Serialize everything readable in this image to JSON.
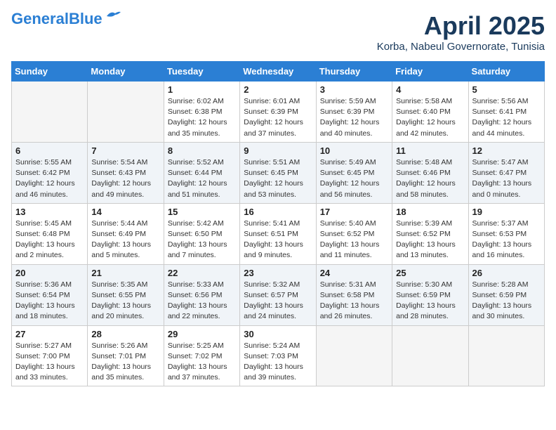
{
  "header": {
    "logo_line1": "General",
    "logo_line2": "Blue",
    "month_year": "April 2025",
    "location": "Korba, Nabeul Governorate, Tunisia"
  },
  "weekdays": [
    "Sunday",
    "Monday",
    "Tuesday",
    "Wednesday",
    "Thursday",
    "Friday",
    "Saturday"
  ],
  "weeks": [
    [
      {
        "day": "",
        "detail": ""
      },
      {
        "day": "",
        "detail": ""
      },
      {
        "day": "1",
        "detail": "Sunrise: 6:02 AM\nSunset: 6:38 PM\nDaylight: 12 hours\nand 35 minutes."
      },
      {
        "day": "2",
        "detail": "Sunrise: 6:01 AM\nSunset: 6:39 PM\nDaylight: 12 hours\nand 37 minutes."
      },
      {
        "day": "3",
        "detail": "Sunrise: 5:59 AM\nSunset: 6:39 PM\nDaylight: 12 hours\nand 40 minutes."
      },
      {
        "day": "4",
        "detail": "Sunrise: 5:58 AM\nSunset: 6:40 PM\nDaylight: 12 hours\nand 42 minutes."
      },
      {
        "day": "5",
        "detail": "Sunrise: 5:56 AM\nSunset: 6:41 PM\nDaylight: 12 hours\nand 44 minutes."
      }
    ],
    [
      {
        "day": "6",
        "detail": "Sunrise: 5:55 AM\nSunset: 6:42 PM\nDaylight: 12 hours\nand 46 minutes."
      },
      {
        "day": "7",
        "detail": "Sunrise: 5:54 AM\nSunset: 6:43 PM\nDaylight: 12 hours\nand 49 minutes."
      },
      {
        "day": "8",
        "detail": "Sunrise: 5:52 AM\nSunset: 6:44 PM\nDaylight: 12 hours\nand 51 minutes."
      },
      {
        "day": "9",
        "detail": "Sunrise: 5:51 AM\nSunset: 6:45 PM\nDaylight: 12 hours\nand 53 minutes."
      },
      {
        "day": "10",
        "detail": "Sunrise: 5:49 AM\nSunset: 6:45 PM\nDaylight: 12 hours\nand 56 minutes."
      },
      {
        "day": "11",
        "detail": "Sunrise: 5:48 AM\nSunset: 6:46 PM\nDaylight: 12 hours\nand 58 minutes."
      },
      {
        "day": "12",
        "detail": "Sunrise: 5:47 AM\nSunset: 6:47 PM\nDaylight: 13 hours\nand 0 minutes."
      }
    ],
    [
      {
        "day": "13",
        "detail": "Sunrise: 5:45 AM\nSunset: 6:48 PM\nDaylight: 13 hours\nand 2 minutes."
      },
      {
        "day": "14",
        "detail": "Sunrise: 5:44 AM\nSunset: 6:49 PM\nDaylight: 13 hours\nand 5 minutes."
      },
      {
        "day": "15",
        "detail": "Sunrise: 5:42 AM\nSunset: 6:50 PM\nDaylight: 13 hours\nand 7 minutes."
      },
      {
        "day": "16",
        "detail": "Sunrise: 5:41 AM\nSunset: 6:51 PM\nDaylight: 13 hours\nand 9 minutes."
      },
      {
        "day": "17",
        "detail": "Sunrise: 5:40 AM\nSunset: 6:52 PM\nDaylight: 13 hours\nand 11 minutes."
      },
      {
        "day": "18",
        "detail": "Sunrise: 5:39 AM\nSunset: 6:52 PM\nDaylight: 13 hours\nand 13 minutes."
      },
      {
        "day": "19",
        "detail": "Sunrise: 5:37 AM\nSunset: 6:53 PM\nDaylight: 13 hours\nand 16 minutes."
      }
    ],
    [
      {
        "day": "20",
        "detail": "Sunrise: 5:36 AM\nSunset: 6:54 PM\nDaylight: 13 hours\nand 18 minutes."
      },
      {
        "day": "21",
        "detail": "Sunrise: 5:35 AM\nSunset: 6:55 PM\nDaylight: 13 hours\nand 20 minutes."
      },
      {
        "day": "22",
        "detail": "Sunrise: 5:33 AM\nSunset: 6:56 PM\nDaylight: 13 hours\nand 22 minutes."
      },
      {
        "day": "23",
        "detail": "Sunrise: 5:32 AM\nSunset: 6:57 PM\nDaylight: 13 hours\nand 24 minutes."
      },
      {
        "day": "24",
        "detail": "Sunrise: 5:31 AM\nSunset: 6:58 PM\nDaylight: 13 hours\nand 26 minutes."
      },
      {
        "day": "25",
        "detail": "Sunrise: 5:30 AM\nSunset: 6:59 PM\nDaylight: 13 hours\nand 28 minutes."
      },
      {
        "day": "26",
        "detail": "Sunrise: 5:28 AM\nSunset: 6:59 PM\nDaylight: 13 hours\nand 30 minutes."
      }
    ],
    [
      {
        "day": "27",
        "detail": "Sunrise: 5:27 AM\nSunset: 7:00 PM\nDaylight: 13 hours\nand 33 minutes."
      },
      {
        "day": "28",
        "detail": "Sunrise: 5:26 AM\nSunset: 7:01 PM\nDaylight: 13 hours\nand 35 minutes."
      },
      {
        "day": "29",
        "detail": "Sunrise: 5:25 AM\nSunset: 7:02 PM\nDaylight: 13 hours\nand 37 minutes."
      },
      {
        "day": "30",
        "detail": "Sunrise: 5:24 AM\nSunset: 7:03 PM\nDaylight: 13 hours\nand 39 minutes."
      },
      {
        "day": "",
        "detail": ""
      },
      {
        "day": "",
        "detail": ""
      },
      {
        "day": "",
        "detail": ""
      }
    ]
  ]
}
